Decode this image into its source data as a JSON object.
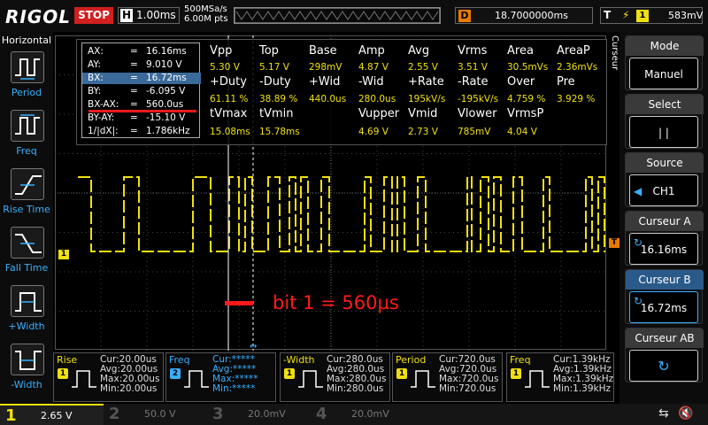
{
  "topbar": {
    "logo": "RIGOL",
    "run_state": "STOP",
    "horiz_label": "H",
    "timebase": "1.00ms",
    "sample_rate": "500MSa/s",
    "mem_depth": "6.00M pts",
    "delay_label": "D",
    "delay": "18.7000000ms",
    "trigger_label": "T",
    "trigger_source": "1",
    "trigger_level": "583mV"
  },
  "left_menu": {
    "title": "Horizontal",
    "items": [
      {
        "label": "Period",
        "icon": "period-icon"
      },
      {
        "label": "Freq",
        "icon": "frequency-icon"
      },
      {
        "label": "Rise Time",
        "icon": "rise-time-icon"
      },
      {
        "label": "Fall Time",
        "icon": "fall-time-icon"
      },
      {
        "label": "+Width",
        "icon": "positive-width-icon"
      },
      {
        "label": "-Width",
        "icon": "negative-width-icon"
      }
    ]
  },
  "right_menu": {
    "vertical_tab": "Curseur",
    "mode": {
      "title": "Mode",
      "value": "Manuel"
    },
    "select": {
      "title": "Select",
      "value": "| |"
    },
    "source": {
      "title": "Source",
      "value": "CH1"
    },
    "cursor_a": {
      "title": "Curseur A",
      "value": "16.16ms"
    },
    "cursor_b": {
      "title": "Curseur B",
      "value": "16.72ms"
    },
    "cursor_ab": {
      "title": "Curseur AB"
    }
  },
  "cursors": [
    {
      "k": "AX:",
      "e": "=",
      "v": "16.16ms"
    },
    {
      "k": "AY:",
      "e": "=",
      "v": "9.010 V"
    },
    {
      "k": "BX:",
      "e": "=",
      "v": "16.72ms"
    },
    {
      "k": "BY:",
      "e": "=",
      "v": "-6.095 V"
    },
    {
      "k": "BX-AX:",
      "e": "=",
      "v": "560.0us"
    },
    {
      "k": "BY-AY:",
      "e": "=",
      "v": "-15.10 V"
    },
    {
      "k": "1/|dX|:",
      "e": "=",
      "v": "1.786kHz"
    }
  ],
  "measurements": {
    "row1_titles": [
      "Vpp",
      "Top",
      "Base",
      "Amp",
      "Avg",
      "Vrms",
      "Area",
      "AreaP"
    ],
    "row1_values": [
      "5.30 V",
      "5.17 V",
      "298mV",
      "4.87 V",
      "2.55 V",
      "3.51 V",
      "30.5mVs",
      "2.36mVs"
    ],
    "row2_titles": [
      "+Duty",
      "-Duty",
      "+Wid",
      "-Wid",
      "+Rate",
      "-Rate",
      "Over",
      "Pre"
    ],
    "row2_values": [
      "61.11 %",
      "38.89 %",
      "440.0us",
      "280.0us",
      "195kV/s",
      "-195kV/s",
      "4.759 %",
      "3.929 %"
    ],
    "row3_titles": [
      "tVmax",
      "tVmin",
      "Vupper",
      "Vmid",
      "Vlower",
      "VrmsP"
    ],
    "row3_values": [
      "15.08ms",
      "15.78ms",
      "4.69 V",
      "2.73 V",
      "785mV",
      "4.04 V"
    ]
  },
  "annotation": "bit 1 = 560µs",
  "markers": {
    "ch1": "1",
    "trig": "T"
  },
  "bottom_measures": [
    {
      "name": "Rise",
      "ch": "1",
      "cur": "Cur:20.00us",
      "avg": "Avg:20.00us",
      "max": "Max:20.00us",
      "min": "Min:20.00us",
      "color": "#f0e010"
    },
    {
      "name": "Freq",
      "ch": "2",
      "cur": "Cur:*****",
      "avg": "Avg:*****",
      "max": "Max:*****",
      "min": "Min:*****",
      "color": "#39b0ff"
    },
    {
      "name": "-Width",
      "ch": "1",
      "cur": "Cur:280.0us",
      "avg": "Avg:280.0us",
      "max": "Max:280.0us",
      "min": "Min:280.0us",
      "color": "#f0e010"
    },
    {
      "name": "Period",
      "ch": "1",
      "cur": "Cur:720.0us",
      "avg": "Avg:720.0us",
      "max": "Max:720.0us",
      "min": "Min:720.0us",
      "color": "#f0e010"
    },
    {
      "name": "Freq",
      "ch": "1",
      "cur": "Cur:1.39kHz",
      "avg": "Avg:1.39kHz",
      "max": "Max:1.39kHz",
      "min": "Min:1.39kHz",
      "color": "#f0e010"
    }
  ],
  "channels": [
    {
      "num": "1",
      "val": "2.65 V",
      "color": "#f0e010"
    },
    {
      "num": "2",
      "val": "50.0 V",
      "color": "#39b0ff"
    },
    {
      "num": "3",
      "val": "20.0mV",
      "color": "#d040d0"
    },
    {
      "num": "4",
      "val": "20.0mV",
      "color": "#3060ff"
    }
  ],
  "colors": {
    "ch1": "#f0e010",
    "accent": "#39b0ff",
    "stop": "#d02020",
    "annotation": "#ff1a1a"
  }
}
